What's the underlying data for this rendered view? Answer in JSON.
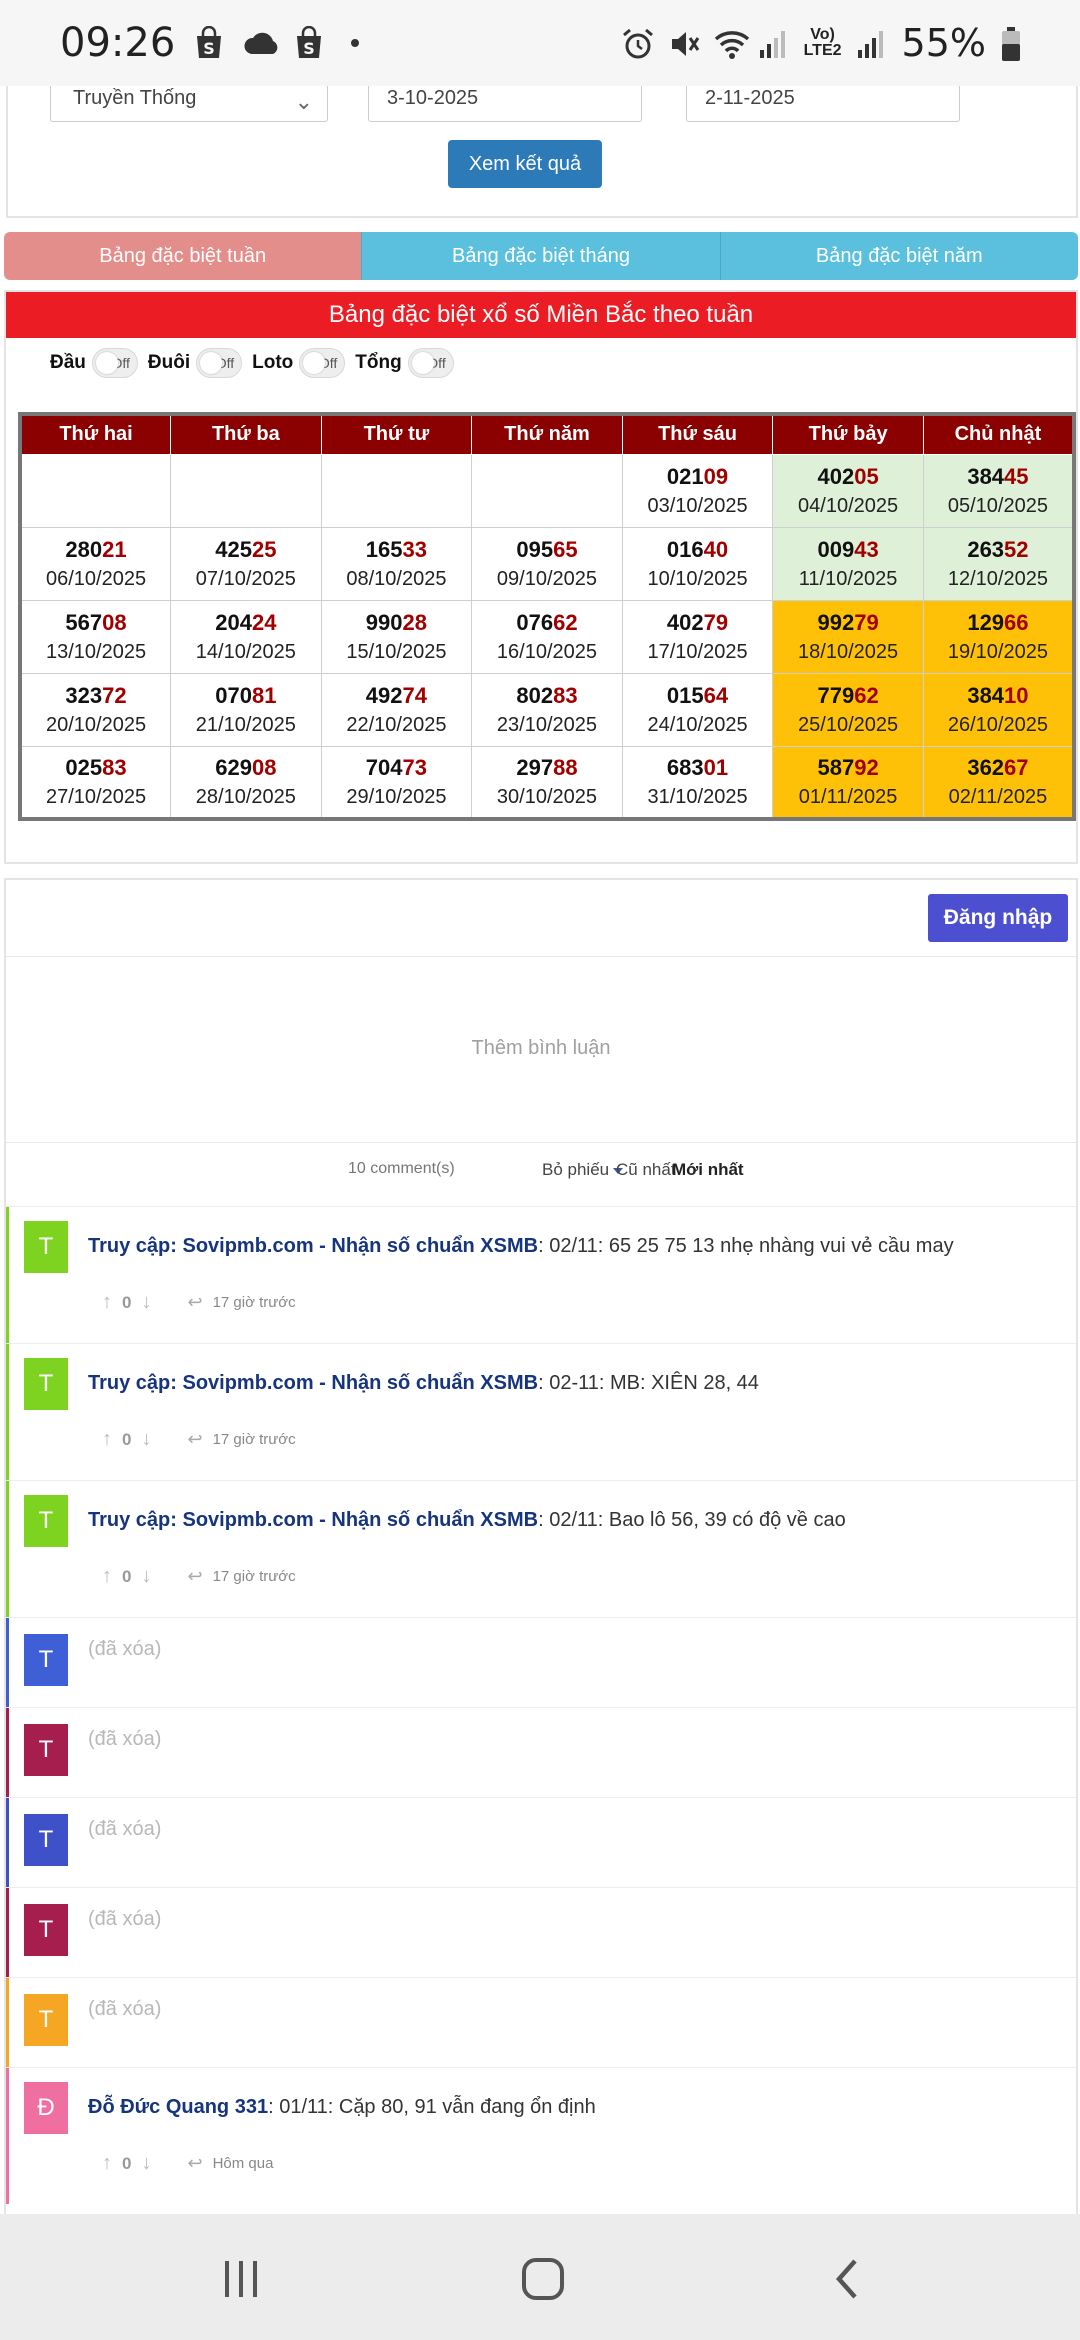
{
  "status_bar": {
    "time": "09:26",
    "battery": "55%",
    "network_label_top": "Vo)",
    "network_label_bottom": "LTE2",
    "icons": [
      "shopping-bag-icon",
      "cloud-icon",
      "shopping-bag-icon",
      "alarm-icon",
      "mute-icon",
      "wifi-icon",
      "signal-icon",
      "battery-icon"
    ]
  },
  "form": {
    "type_select": "Truyền Thống",
    "date_from": "3-10-2025",
    "date_to": "2-11-2025",
    "submit_label": "Xem kết quả"
  },
  "tabs": [
    {
      "label": "Bảng đặc biệt tuần",
      "active": true
    },
    {
      "label": "Bảng đặc biệt tháng",
      "active": false
    },
    {
      "label": "Bảng đặc biệt năm",
      "active": false
    }
  ],
  "table": {
    "title": "Bảng đặc biệt xổ số Miền Bắc theo tuần",
    "toggles": [
      {
        "label": "Đầu",
        "state": "Off"
      },
      {
        "label": "Đuôi",
        "state": "Off"
      },
      {
        "label": "Loto",
        "state": "Off"
      },
      {
        "label": "Tổng",
        "state": "Off"
      }
    ],
    "headers": [
      "Thứ hai",
      "Thứ ba",
      "Thứ tư",
      "Thứ năm",
      "Thứ sáu",
      "Thứ bảy",
      "Chủ nhật"
    ],
    "rows": [
      [
        null,
        null,
        null,
        null,
        {
          "head": "021",
          "tail": "09",
          "date": "03/10/2025"
        },
        {
          "head": "402",
          "tail": "05",
          "date": "04/10/2025"
        },
        {
          "head": "384",
          "tail": "45",
          "date": "05/10/2025"
        }
      ],
      [
        {
          "head": "280",
          "tail": "21",
          "date": "06/10/2025"
        },
        {
          "head": "425",
          "tail": "25",
          "date": "07/10/2025"
        },
        {
          "head": "165",
          "tail": "33",
          "date": "08/10/2025"
        },
        {
          "head": "095",
          "tail": "65",
          "date": "09/10/2025"
        },
        {
          "head": "016",
          "tail": "40",
          "date": "10/10/2025"
        },
        {
          "head": "009",
          "tail": "43",
          "date": "11/10/2025"
        },
        {
          "head": "263",
          "tail": "52",
          "date": "12/10/2025"
        }
      ],
      [
        {
          "head": "567",
          "tail": "08",
          "date": "13/10/2025"
        },
        {
          "head": "204",
          "tail": "24",
          "date": "14/10/2025"
        },
        {
          "head": "990",
          "tail": "28",
          "date": "15/10/2025"
        },
        {
          "head": "076",
          "tail": "62",
          "date": "16/10/2025"
        },
        {
          "head": "402",
          "tail": "79",
          "date": "17/10/2025"
        },
        {
          "head": "992",
          "tail": "79",
          "date": "18/10/2025"
        },
        {
          "head": "129",
          "tail": "66",
          "date": "19/10/2025"
        }
      ],
      [
        {
          "head": "323",
          "tail": "72",
          "date": "20/10/2025"
        },
        {
          "head": "070",
          "tail": "81",
          "date": "21/10/2025"
        },
        {
          "head": "492",
          "tail": "74",
          "date": "22/10/2025"
        },
        {
          "head": "802",
          "tail": "83",
          "date": "23/10/2025"
        },
        {
          "head": "015",
          "tail": "64",
          "date": "24/10/2025"
        },
        {
          "head": "779",
          "tail": "62",
          "date": "25/10/2025"
        },
        {
          "head": "384",
          "tail": "10",
          "date": "26/10/2025"
        }
      ],
      [
        {
          "head": "025",
          "tail": "83",
          "date": "27/10/2025"
        },
        {
          "head": "629",
          "tail": "08",
          "date": "28/10/2025"
        },
        {
          "head": "704",
          "tail": "73",
          "date": "29/10/2025"
        },
        {
          "head": "297",
          "tail": "88",
          "date": "30/10/2025"
        },
        {
          "head": "683",
          "tail": "01",
          "date": "31/10/2025"
        },
        {
          "head": "587",
          "tail": "92",
          "date": "01/11/2025"
        },
        {
          "head": "362",
          "tail": "67",
          "date": "02/11/2025"
        }
      ]
    ],
    "colors": {
      "header": "#8b0000",
      "weekend_green": "#dff0d8",
      "weekend_gold": "#ffc107",
      "tail_red": "#a10000",
      "title_red": "#ec1c24"
    }
  },
  "comments_section": {
    "login_label": "Đăng nhập",
    "add_comment_placeholder": "Thêm bình luận",
    "count_label": "10 comment(s)",
    "sort_options": [
      "Bỏ phiếu",
      "Cũ nhất",
      "Mới nhất"
    ],
    "active_sort": "Mới nhất",
    "comments": [
      {
        "avatar": "T",
        "color": "#7ed321",
        "author": "Truy cập: Sovipmb.com - Nhận số chuẩn XSMB",
        "text": ": 02/11: 65 25 75 13 nhẹ nhàng vui vẻ cầu may",
        "score": "0",
        "time": "17 giờ trước",
        "deleted": false
      },
      {
        "avatar": "T",
        "color": "#7ed321",
        "author": "Truy cập: Sovipmb.com - Nhận số chuẩn XSMB",
        "text": ": 02-11: MB: XIÊN 28, 44",
        "score": "0",
        "time": "17 giờ trước",
        "deleted": false
      },
      {
        "avatar": "T",
        "color": "#7ed321",
        "author": "Truy cập: Sovipmb.com - Nhận số chuẩn XSMB",
        "text": ": 02/11: Bao lô 56, 39 có độ về cao",
        "score": "0",
        "time": "17 giờ trước",
        "deleted": false
      },
      {
        "avatar": "T",
        "color": "#3f5fd6",
        "deleted_label": "(đã xóa)",
        "deleted": true
      },
      {
        "avatar": "T",
        "color": "#a61e4d",
        "deleted_label": "(đã xóa)",
        "deleted": true
      },
      {
        "avatar": "T",
        "color": "#3f51c8",
        "deleted_label": "(đã xóa)",
        "deleted": true
      },
      {
        "avatar": "T",
        "color": "#a61e4d",
        "deleted_label": "(đã xóa)",
        "deleted": true
      },
      {
        "avatar": "T",
        "color": "#f5a623",
        "deleted_label": "(đã xóa)",
        "deleted": true
      },
      {
        "avatar": "Đ",
        "color": "#ef6fa0",
        "author": "Đỗ Đức Quang 331",
        "text": ": 01/11: Cặp 80, 91 vẫn đang ổn định",
        "score": "0",
        "time": "Hôm qua",
        "deleted": false
      }
    ]
  },
  "nav_bar": {
    "buttons": [
      "recent-apps-icon",
      "home-icon",
      "back-icon"
    ]
  }
}
